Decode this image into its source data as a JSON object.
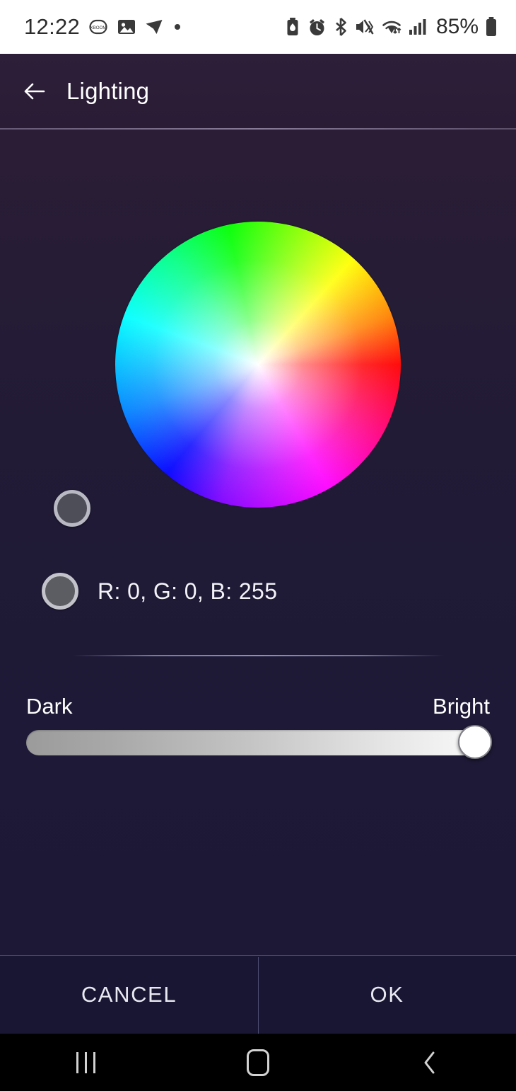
{
  "status_bar": {
    "time": "12:22",
    "battery_percent": "85%",
    "left_icons": [
      "xboom-icon",
      "image-icon",
      "telegram-icon",
      "dot-indicator-icon"
    ],
    "right_icons": [
      "battery-saver-icon",
      "alarm-icon",
      "bluetooth-icon",
      "mute-vibrate-icon",
      "wifi-icon",
      "signal-bars-icon",
      "battery-icon"
    ],
    "background_color": "#ffffff",
    "foreground_color": "#2b2b2b"
  },
  "app_bar": {
    "title": "Lighting",
    "back_icon": "arrow-left-icon",
    "background_color": "#2d1f39"
  },
  "color_picker": {
    "wheel_name": "color-wheel",
    "handle": {
      "name": "color-wheel-handle",
      "fill_color": "#4e4e59",
      "ring_color": "#b9b9c4"
    },
    "selected": {
      "label": "R: 0, G: 0, B: 255",
      "r": 0,
      "g": 0,
      "b": 255,
      "swatch_fill": "#5c5c63",
      "swatch_ring": "#c3c3cb"
    }
  },
  "brightness": {
    "min_label": "Dark",
    "max_label": "Bright",
    "value_percent": 95,
    "track_start_color": "#9b9b9b",
    "track_end_color": "#fbfbfb",
    "thumb_color": "#ffffff"
  },
  "actions": {
    "cancel_label": "CANCEL",
    "ok_label": "OK"
  },
  "nav_bar": {
    "recents_icon": "recents-icon",
    "home_icon": "home-icon",
    "back_icon": "chevron-left-icon",
    "background_color": "#000000"
  }
}
